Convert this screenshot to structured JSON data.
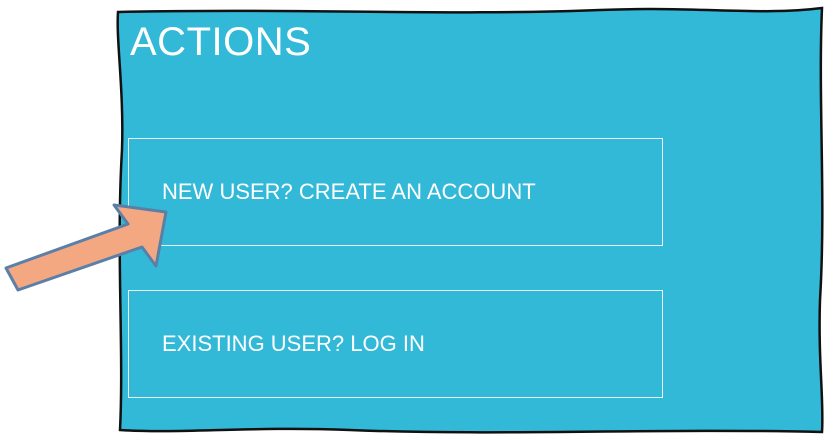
{
  "panel": {
    "heading": "ACTIONS",
    "background_color": "#33b9d8"
  },
  "actions": {
    "create_account_label": "NEW USER? CREATE AN ACCOUNT",
    "login_label": "EXISTING USER? LOG IN"
  },
  "annotation": {
    "arrow_color": "#f4a882",
    "arrow_stroke_color": "#5b7fa6",
    "points_to": "create-account-button"
  }
}
